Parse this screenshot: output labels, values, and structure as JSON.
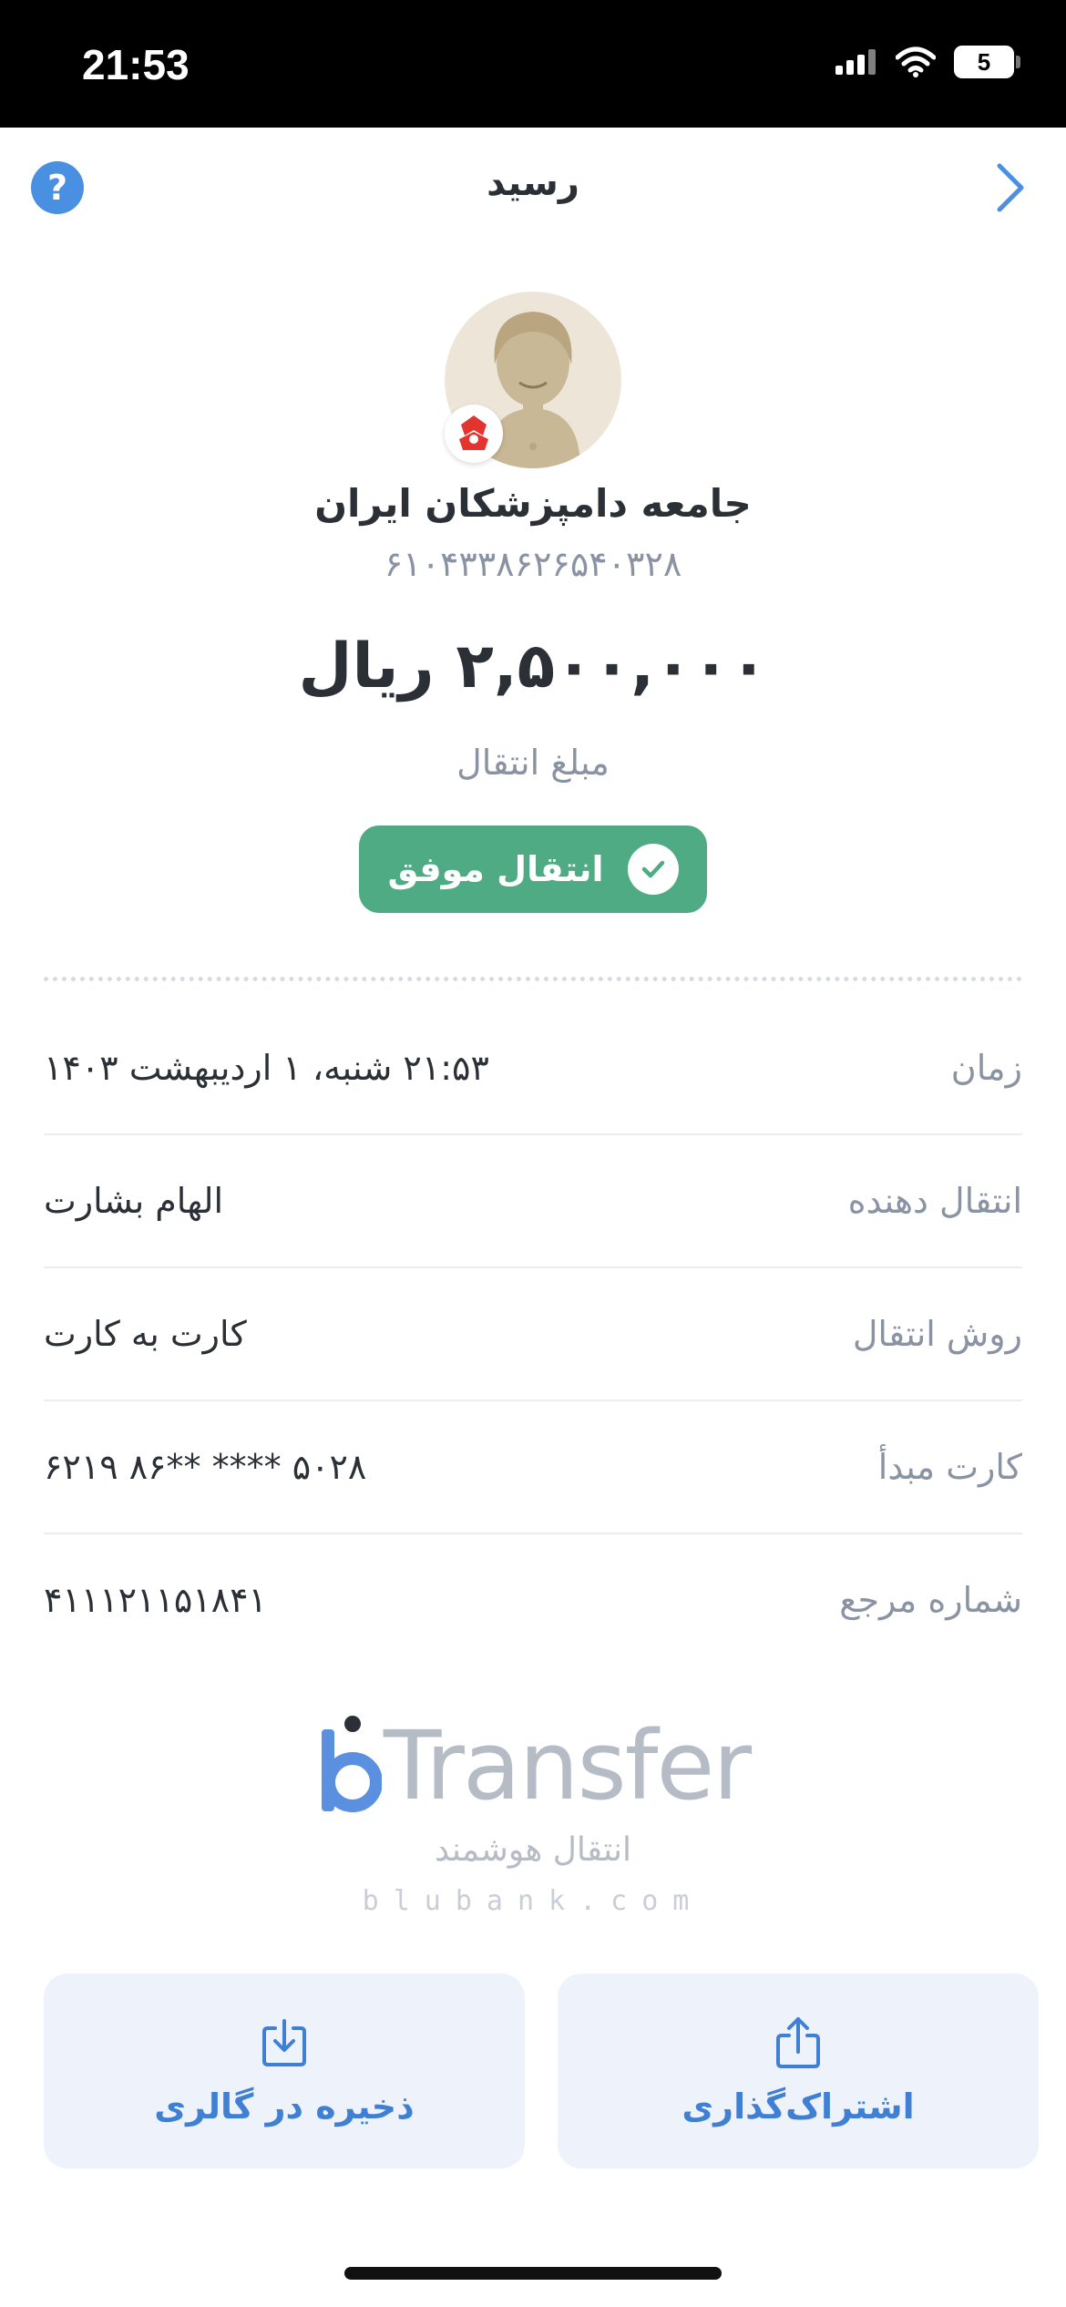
{
  "status_bar": {
    "time": "21:53",
    "battery": "5",
    "icons": [
      "signal-icon",
      "wifi-icon",
      "battery-charging-icon"
    ]
  },
  "header": {
    "title": "رسید",
    "help_icon": "question-icon",
    "back_icon": "chevron-right-icon"
  },
  "recipient": {
    "name": "جامعه دامپزشکان ایران",
    "card_number": "۶۱۰۴۳۳۸۶۲۶۵۴۰۳۲۸"
  },
  "amount": {
    "value": "۲,۵۰۰,۰۰۰ ریال",
    "label": "مبلغ انتقال"
  },
  "status": {
    "text": "انتقال موفق",
    "color": "#4fab84"
  },
  "details": [
    {
      "label": "زمان",
      "value": "۲۱:۵۳ شنبه، ۱ اردیبهشت ۱۴۰۳"
    },
    {
      "label": "انتقال دهنده",
      "value": "الهام بشارت"
    },
    {
      "label": "روش انتقال",
      "value": "کارت به کارت"
    },
    {
      "label": "کارت مبدأ",
      "value": "۶۲۱۹ ۸۶** **** ۵۰۲۸"
    },
    {
      "label": "شماره مرجع",
      "value": "۴۱۱۱۲۱۱۵۱۸۴۱"
    }
  ],
  "brand": {
    "logo_letter": "b",
    "logo_word": "Transfer",
    "tagline": "انتقال هوشمند",
    "domain": "blubank.com"
  },
  "actions": {
    "save_label": "ذخیره در گالری",
    "share_label": "اشتراک‌گذاری"
  },
  "colors": {
    "accent": "#4a90e2",
    "button_bg": "#eef3fb",
    "button_text": "#3f7fd4"
  }
}
